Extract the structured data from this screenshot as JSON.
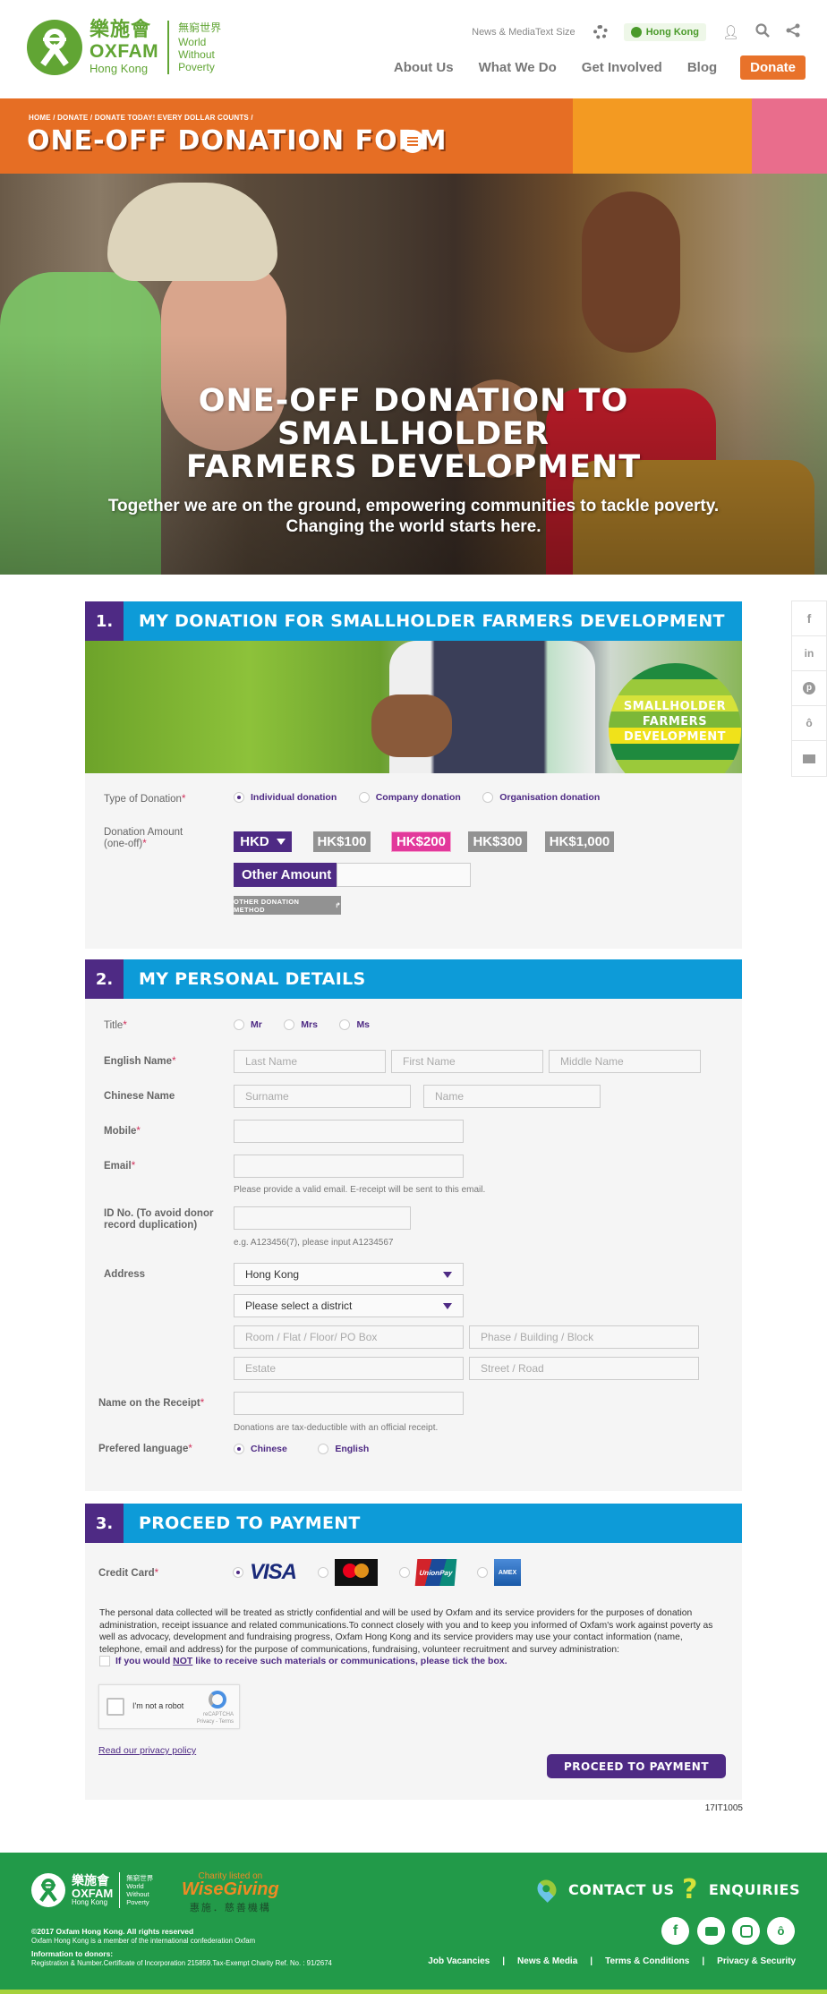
{
  "header": {
    "logo": {
      "zh": "樂施會",
      "en": "OXFAM",
      "region": "Hong Kong",
      "tagline_zh": "無窮世界",
      "tagline_en": [
        "World",
        "Without",
        "Poverty"
      ]
    },
    "utility": {
      "news_media": "News & Media",
      "text_size": "Text Size",
      "region_label": "Hong Kong"
    },
    "nav": [
      {
        "label": "About Us"
      },
      {
        "label": "What We Do"
      },
      {
        "label": "Get Involved"
      },
      {
        "label": "Blog"
      }
    ],
    "donate_label": "Donate"
  },
  "title_band": {
    "breadcrumb": "HOME / DONATE / DONATE TODAY! EVERY DOLLAR COUNTS /",
    "title": "ONE-OFF DONATION FORM"
  },
  "hero": {
    "heading_lines": [
      "ONE-OFF DONATION TO",
      "SMALLHOLDER",
      "FARMERS DEVELOPMENT"
    ],
    "subtitle_lines": [
      "Together we are on the ground, empowering communities to tackle poverty.",
      "Changing the world starts here."
    ]
  },
  "side_share": [
    "f",
    "in",
    "pinterest",
    "weibo",
    "email"
  ],
  "section1": {
    "number": "1.",
    "title": "MY DONATION FOR SMALLHOLDER FARMERS DEVELOPMENT",
    "badge_lines": [
      "SMALLHOLDER",
      "FARMERS",
      "DEVELOPMENT"
    ],
    "type_label": "Type of Donation",
    "type_options": [
      {
        "label": "Individual donation",
        "selected": true
      },
      {
        "label": "Company donation",
        "selected": false
      },
      {
        "label": "Organisation donation",
        "selected": false
      }
    ],
    "amount_label_1": "Donation Amount",
    "amount_label_2": "(one-off)",
    "currency": "HKD",
    "amounts": [
      {
        "label": "HK$100",
        "selected": false
      },
      {
        "label": "HK$200",
        "selected": true
      },
      {
        "label": "HK$300",
        "selected": false
      },
      {
        "label": "HK$1,000",
        "selected": false
      }
    ],
    "other_amount_label": "Other Amount",
    "other_amount_value": "",
    "other_method_label": "OTHER DONATION METHOD"
  },
  "section2": {
    "number": "2.",
    "title": "MY PERSONAL DETAILS",
    "title_label": "Title",
    "title_options": [
      {
        "label": "Mr",
        "selected": false
      },
      {
        "label": "Mrs",
        "selected": false
      },
      {
        "label": "Ms",
        "selected": false
      }
    ],
    "english_name_label": "English Name",
    "english_name_placeholders": [
      "Last Name",
      "First Name",
      "Middle Name"
    ],
    "chinese_name_label": "Chinese Name",
    "chinese_name_placeholders": [
      "Surname",
      "Name"
    ],
    "mobile_label": "Mobile",
    "email_label": "Email",
    "email_hint": "Please provide a valid email. E-receipt will be sent to this email.",
    "id_label_1": "ID No. (To avoid donor",
    "id_label_2": "record duplication)",
    "id_hint": "e.g. A123456(7), please input A1234567",
    "address_label": "Address",
    "address_region": "Hong Kong",
    "address_district": "Please select a district",
    "address_placeholders": [
      "Room / Flat / Floor/ PO Box",
      "Phase / Building / Block",
      "Estate",
      "Street / Road"
    ],
    "receipt_label": "Name on the Receipt",
    "receipt_hint": "Donations are tax-deductible with an official receipt.",
    "language_label": "Prefered language",
    "language_options": [
      {
        "label": "Chinese",
        "selected": true
      },
      {
        "label": "English",
        "selected": false
      }
    ]
  },
  "section3": {
    "number": "3.",
    "title": "PROCEED TO PAYMENT",
    "card_label": "Credit Card",
    "cards": [
      {
        "name": "VISA",
        "selected": true
      },
      {
        "name": "mastercard",
        "selected": false
      },
      {
        "name": "UnionPay",
        "selected": false
      },
      {
        "name": "AMEX",
        "selected": false
      }
    ],
    "privacy_text": "The personal data collected will be treated as strictly confidential and will be used by Oxfam and its service providers for the purposes of donation administration, receipt issuance and related communications.To connect closely with you and to keep you informed of Oxfam's work against poverty as well as advocacy, development and fundraising progress, Oxfam Hong Kong and its service providers may use your contact information (name, telephone, email and address) for the purpose of communications, fundraising, volunteer recruitment and survey administration:",
    "optout_pre": "If you would ",
    "optout_not": "NOT",
    "optout_post": " like to receive such materials or communications, please tick the box.",
    "captcha_label": "I'm not a robot",
    "captcha_brand": "reCAPTCHA",
    "captcha_links": "Privacy - Terms",
    "privacy_link": "Read our privacy policy",
    "proceed_label": "PROCEED TO PAYMENT"
  },
  "form_code": "17IT1005",
  "footer": {
    "logo": {
      "zh": "樂施會",
      "en": "OXFAM",
      "region": "Hong Kong",
      "tagline_zh": "無窮世界",
      "tagline_en": [
        "World",
        "Without",
        "Poverty"
      ]
    },
    "wise": {
      "top": "Charity listed on",
      "brand": "WiseGiving",
      "zh": "惠施．慈善機構"
    },
    "copyright": "©2017 Oxfam Hong Kong. All rights reserved",
    "member": "Oxfam Hong Kong is a member of the international confederation Oxfam",
    "donor_info_title": "Information to donors:",
    "donor_info": "Registration & Number.Certificate of Incorporation 215859.Tax-Exempt Charity Ref. No. : 91/2674",
    "contact_label": "CONTACT US",
    "enquiries_label": "ENQUIRIES",
    "social": [
      "facebook",
      "youtube",
      "instagram",
      "weibo"
    ],
    "links": [
      "Job Vacancies",
      "News & Media",
      "Terms & Conditions",
      "Privacy & Security"
    ]
  },
  "colors": {
    "brand_green": "#61a534",
    "orange": "#e66e24",
    "purple": "#4e2a84",
    "blue": "#0d9bd8",
    "pink": "#e2389b",
    "footer_green": "#229a49"
  }
}
